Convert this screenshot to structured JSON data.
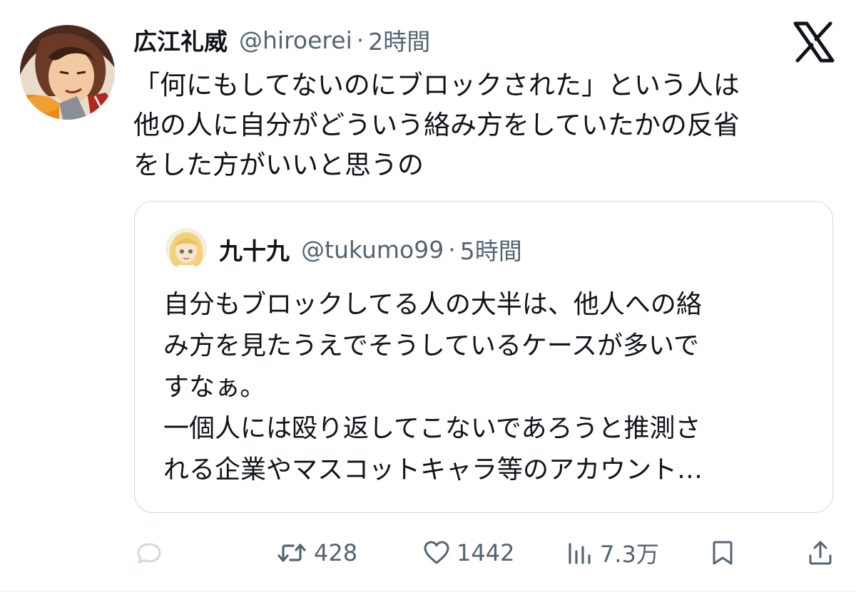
{
  "tweet": {
    "author": {
      "name": "広江礼威",
      "handle": "@hiroerei",
      "time": "2時間"
    },
    "separator": "·",
    "text_lines": [
      "「何にもしてないのにブロックされた」という人は",
      "他の人に自分がどういう絡み方をしていたかの反省",
      "をした方がいいと思うの"
    ],
    "quote": {
      "author": {
        "name": "九十九",
        "handle": "@tukumo99",
        "time": "5時間"
      },
      "text_lines": [
        "自分もブロックしてる人の大半は、他人への絡",
        "み方を見たうえでそうしているケースが多いで",
        "すなぁ。",
        "一個人には殴り返してこないであろうと推測さ",
        "れる企業やマスコットキャラ等のアカウント…"
      ]
    },
    "actions": {
      "reply_icon": "reply-icon",
      "retweet_icon": "retweet-icon",
      "retweet_count": "428",
      "like_icon": "heart-icon",
      "like_count": "1442",
      "views_icon": "views-bar-chart-icon",
      "views_count": "7.3万",
      "bookmark_icon": "bookmark-icon",
      "share_icon": "share-icon"
    }
  },
  "colors": {
    "primary_text": "#0f1419",
    "secondary_text": "#536471",
    "border": "#cfd9de",
    "reply_icon_muted": "#cfd9de"
  },
  "brand_icon": "x-logo-icon"
}
